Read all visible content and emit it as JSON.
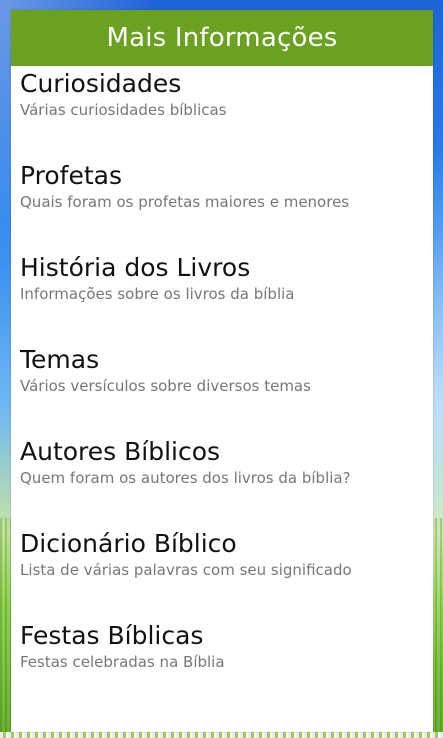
{
  "header": {
    "title": "Mais Informações"
  },
  "items": [
    {
      "title": "Curiosidades",
      "subtitle": "Várias curiosidades bíblicas"
    },
    {
      "title": "Profetas",
      "subtitle": "Quais foram os profetas maiores e menores"
    },
    {
      "title": "História dos Livros",
      "subtitle": "Informações sobre os livros da bíblia"
    },
    {
      "title": "Temas",
      "subtitle": "Vários versículos sobre diversos temas"
    },
    {
      "title": "Autores Bíblicos",
      "subtitle": "Quem foram os autores dos livros da bíblia?"
    },
    {
      "title": "Dicionário Bíblico",
      "subtitle": "Lista de várias palavras com seu significado"
    },
    {
      "title": "Festas Bíblicas",
      "subtitle": "Festas celebradas na Bíblia"
    }
  ],
  "colors": {
    "header": "#6aa120",
    "title": "#111111",
    "subtitle": "#777777"
  }
}
